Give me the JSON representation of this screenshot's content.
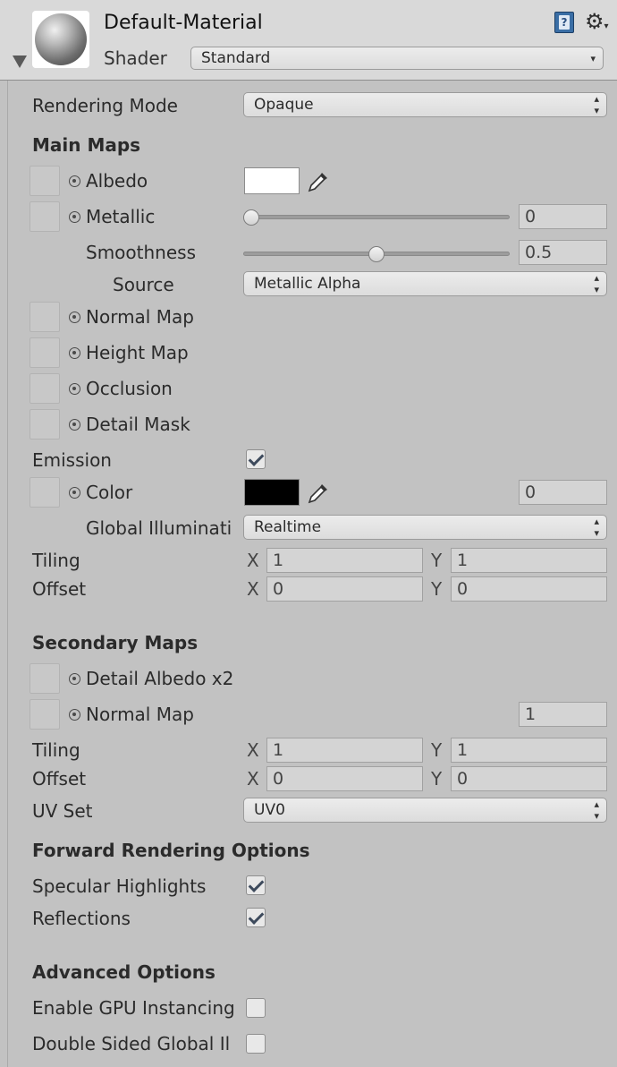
{
  "header": {
    "title": "Default-Material",
    "shader_label": "Shader",
    "shader_value": "Standard",
    "icons": [
      "material-sphere-icon",
      "book-help-icon",
      "gear-icon",
      "foldout-arrow-icon"
    ]
  },
  "rendering_mode": {
    "label": "Rendering Mode",
    "value": "Opaque"
  },
  "main_maps": {
    "title": "Main Maps",
    "albedo": {
      "label": "Albedo",
      "color": "#ffffff"
    },
    "metallic": {
      "label": "Metallic",
      "value": "0",
      "level": 0.0
    },
    "smoothness": {
      "label": "Smoothness",
      "value": "0.5",
      "level": 0.5
    },
    "source": {
      "label": "Source",
      "value": "Metallic Alpha"
    },
    "normal_map": {
      "label": "Normal Map"
    },
    "height_map": {
      "label": "Height Map"
    },
    "occlusion": {
      "label": "Occlusion"
    },
    "detail_mask": {
      "label": "Detail Mask"
    },
    "emission": {
      "label": "Emission",
      "checked": true
    },
    "color": {
      "label": "Color",
      "color": "#000000",
      "value": "0"
    },
    "gi": {
      "label": "Global Illuminati",
      "value": "Realtime"
    },
    "tiling": {
      "label": "Tiling",
      "x_label": "X",
      "x": "1",
      "y_label": "Y",
      "y": "1"
    },
    "offset": {
      "label": "Offset",
      "x_label": "X",
      "x": "0",
      "y_label": "Y",
      "y": "0"
    }
  },
  "secondary_maps": {
    "title": "Secondary Maps",
    "detail_albedo": {
      "label": "Detail Albedo x2"
    },
    "normal_map": {
      "label": "Normal Map",
      "value": "1"
    },
    "tiling": {
      "label": "Tiling",
      "x_label": "X",
      "x": "1",
      "y_label": "Y",
      "y": "1"
    },
    "offset": {
      "label": "Offset",
      "x_label": "X",
      "x": "0",
      "y_label": "Y",
      "y": "0"
    },
    "uv_set": {
      "label": "UV Set",
      "value": "UV0"
    }
  },
  "forward_rendering": {
    "title": "Forward Rendering Options",
    "specular": {
      "label": "Specular Highlights",
      "checked": true
    },
    "reflections": {
      "label": "Reflections",
      "checked": true
    }
  },
  "advanced": {
    "title": "Advanced Options",
    "gpu_instancing": {
      "label": "Enable GPU Instancing",
      "checked": false
    },
    "double_sided": {
      "label": "Double Sided Global Il",
      "checked": false
    }
  }
}
